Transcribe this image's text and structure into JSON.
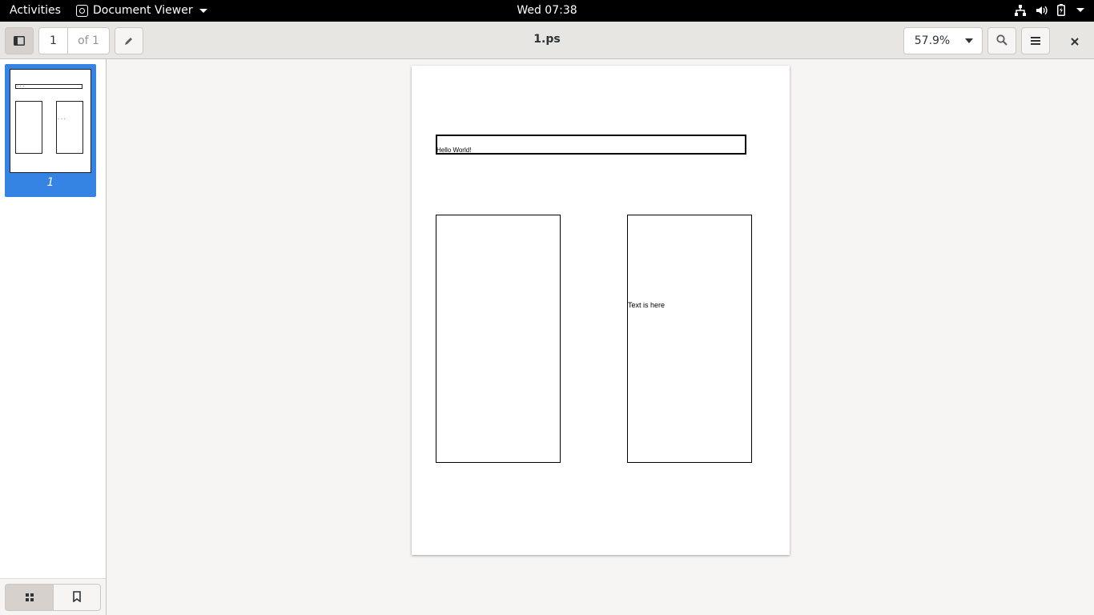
{
  "topbar": {
    "activities": "Activities",
    "app_name": "Document Viewer",
    "clock": "Wed 07:38",
    "icons": [
      "network-icon",
      "volume-icon",
      "battery-icon",
      "system-menu-caret"
    ]
  },
  "header": {
    "sidebar_toggle_icon": "sidebar-icon",
    "page_current": "1",
    "page_of": "of 1",
    "annotate_icon": "pencil-icon",
    "title": "1.ps",
    "zoom": "57.9%",
    "search_icon": "search-icon",
    "menu_icon": "hamburger-icon",
    "close_icon": "close-icon"
  },
  "sidebar": {
    "thumbnails": [
      {
        "label": "1"
      }
    ],
    "footer": {
      "thumbnails_icon": "grid-icon",
      "bookmarks_icon": "bookmark-icon"
    }
  },
  "document": {
    "banner_text": "Hello World!",
    "box_text": "Text is here"
  },
  "colors": {
    "topbar_bg": "#000000",
    "header_bg": "#e8e6e3",
    "selection": "#3584e4",
    "canvas_bg": "#f6f5f4"
  }
}
